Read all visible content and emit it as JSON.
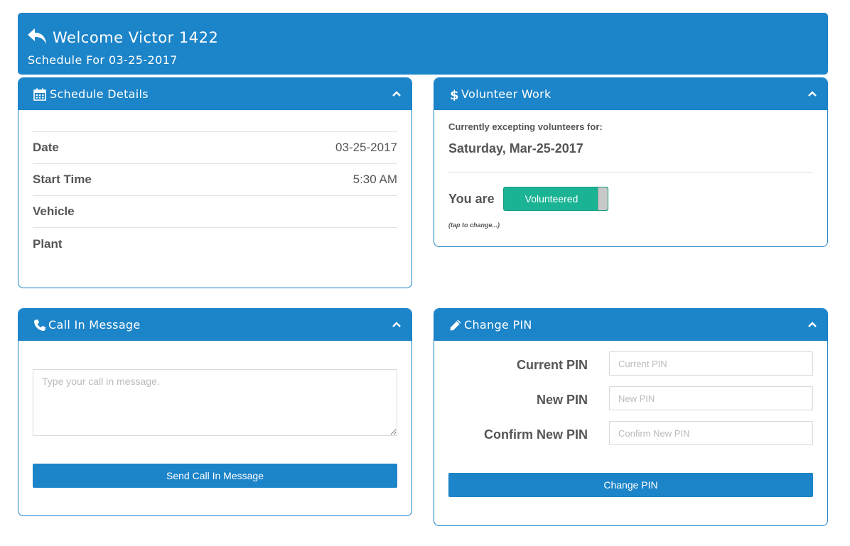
{
  "header": {
    "title": "Welcome Victor 1422",
    "subtitle": "Schedule For 03-25-2017"
  },
  "schedule": {
    "title": "Schedule Details",
    "rows": [
      {
        "label": "Date",
        "value": "03-25-2017"
      },
      {
        "label": "Start Time",
        "value": "5:30 AM"
      },
      {
        "label": "Vehicle",
        "value": ""
      },
      {
        "label": "Plant",
        "value": ""
      }
    ]
  },
  "volunteer": {
    "title": "Volunteer Work",
    "label": "Currently excepting volunteers for:",
    "date": "Saturday, Mar-25-2017",
    "you_are": "You are",
    "toggle_label": "Volunteered",
    "toggle_on": true,
    "hint": "(tap to change...)"
  },
  "callin": {
    "title": "Call In Message",
    "placeholder": "Type your call in message.",
    "button": "Send Call In Message"
  },
  "pin": {
    "title": "Change PIN",
    "current_label": "Current PIN",
    "current_placeholder": "Current PIN",
    "new_label": "New PIN",
    "new_placeholder": "New PIN",
    "confirm_label": "Confirm New PIN",
    "confirm_placeholder": "Confirm New PIN",
    "button": "Change PIN"
  },
  "icons": {
    "back": "reply-arrow-icon",
    "schedule": "calendar-icon",
    "volunteer": "dollar-icon",
    "callin": "phone-icon",
    "pin": "pencil-icon",
    "collapse": "chevron-up-icon"
  },
  "colors": {
    "primary": "#1c84c8",
    "toggle_on": "#1ab394"
  }
}
